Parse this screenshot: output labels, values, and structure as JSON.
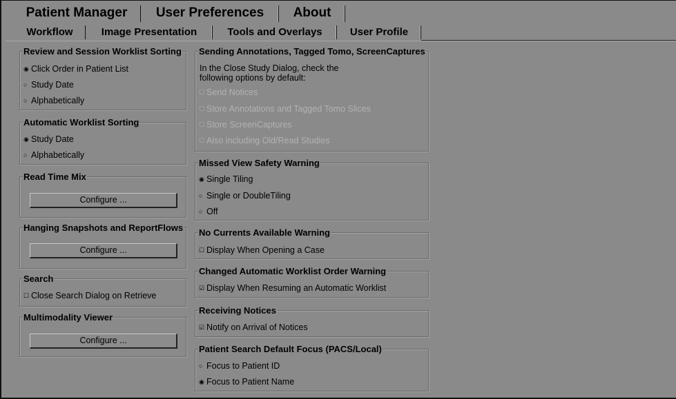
{
  "main_tabs": [
    {
      "label": "Patient Manager",
      "active": false
    },
    {
      "label": "User Preferences",
      "active": true
    },
    {
      "label": "About",
      "active": false
    }
  ],
  "sub_tabs": [
    {
      "label": "Workflow",
      "active": true
    },
    {
      "label": "Image Presentation",
      "active": false
    },
    {
      "label": "Tools and Overlays",
      "active": false
    },
    {
      "label": "User Profile",
      "active": false
    }
  ],
  "review_sorting": {
    "title": "Review and Session Worklist Sorting",
    "options": [
      {
        "label": "Click Order in Patient List",
        "selected": true
      },
      {
        "label": "Study Date",
        "selected": false
      },
      {
        "label": "Alphabetically",
        "selected": false
      }
    ]
  },
  "auto_sorting": {
    "title": "Automatic Worklist Sorting",
    "options": [
      {
        "label": "Study Date",
        "selected": true
      },
      {
        "label": "Alphabetically",
        "selected": false
      }
    ]
  },
  "read_time_mix": {
    "title": "Read Time Mix",
    "button": "Configure ..."
  },
  "hanging_snapshots": {
    "title": "Hanging Snapshots and ReportFlows",
    "button": "Configure ..."
  },
  "search": {
    "title": "Search",
    "checkbox": {
      "label": "Close Search Dialog on Retrieve",
      "checked": false
    }
  },
  "multimodality": {
    "title": "Multimodality Viewer",
    "button": "Configure ..."
  },
  "sending": {
    "title": "Sending Annotations, Tagged Tomo, ScreenCaptures",
    "description_line1": "In the Close Study Dialog, check the",
    "description_line2": "following options by default:",
    "options": [
      {
        "label": "Send Notices",
        "checked": false,
        "disabled": true
      },
      {
        "label": "Store Annotations and Tagged Tomo Slices",
        "checked": false,
        "disabled": true
      },
      {
        "label": "Store ScreenCaptures",
        "checked": false,
        "disabled": true
      },
      {
        "label": "Also including Old/Read Studies",
        "checked": false,
        "disabled": true
      }
    ]
  },
  "missed_view": {
    "title": "Missed View Safety Warning",
    "options": [
      {
        "label": "Single Tiling",
        "selected": true
      },
      {
        "label": "Single or DoubleTiling",
        "selected": false
      },
      {
        "label": "Off",
        "selected": false
      }
    ]
  },
  "no_currents": {
    "title": "No Currents Available Warning",
    "checkbox": {
      "label": "Display When Opening a Case",
      "checked": false
    }
  },
  "changed_order": {
    "title": "Changed Automatic Worklist Order Warning",
    "checkbox": {
      "label": "Display When Resuming an Automatic Worklist",
      "checked": true
    }
  },
  "receiving_notices": {
    "title": "Receiving Notices",
    "checkbox": {
      "label": "Notify on Arrival of Notices",
      "checked": true
    }
  },
  "patient_search": {
    "title": "Patient Search Default Focus (PACS/Local)",
    "options": [
      {
        "label": "Focus to Patient ID",
        "selected": false
      },
      {
        "label": "Focus to Patient Name",
        "selected": true
      }
    ]
  },
  "glyphs": {
    "radio_on": "◉",
    "radio_off": "○",
    "check_on": "☑",
    "check_off": "☐"
  }
}
